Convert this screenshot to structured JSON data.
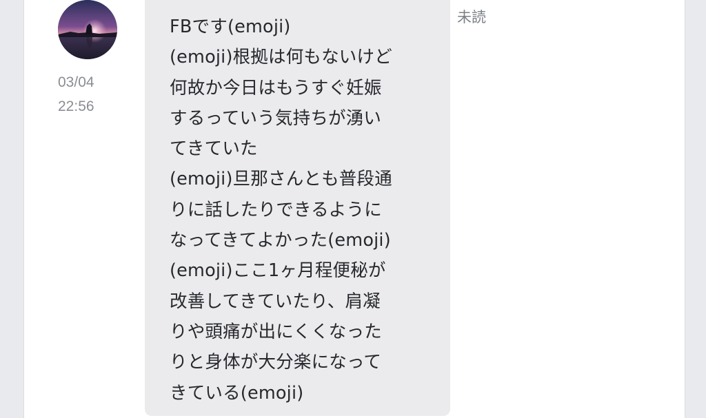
{
  "message": {
    "timestamp": {
      "date": "03/04",
      "time": "22:56"
    },
    "read_status": "未読",
    "lines": [
      "FBです(emoji)",
      "(emoji)根拠は何もないけど",
      "何故か今日はもうすぐ妊娠",
      "するっていう気持ちが湧い",
      "てきていた",
      "(emoji)旦那さんとも普段通",
      "りに話したりできるように",
      "なってきてよかった(emoji)",
      "(emoji)ここ1ヶ月程便秘が",
      "改善してきていたり、肩凝",
      "りや頭痛が出にくくなった",
      "りと身体が大分楽になって",
      "きている(emoji)"
    ]
  },
  "colors": {
    "background": "#e9eaed",
    "panel": "#ffffff",
    "bubble": "#ebebed",
    "text": "#26282c",
    "muted": "#8a8d93"
  }
}
